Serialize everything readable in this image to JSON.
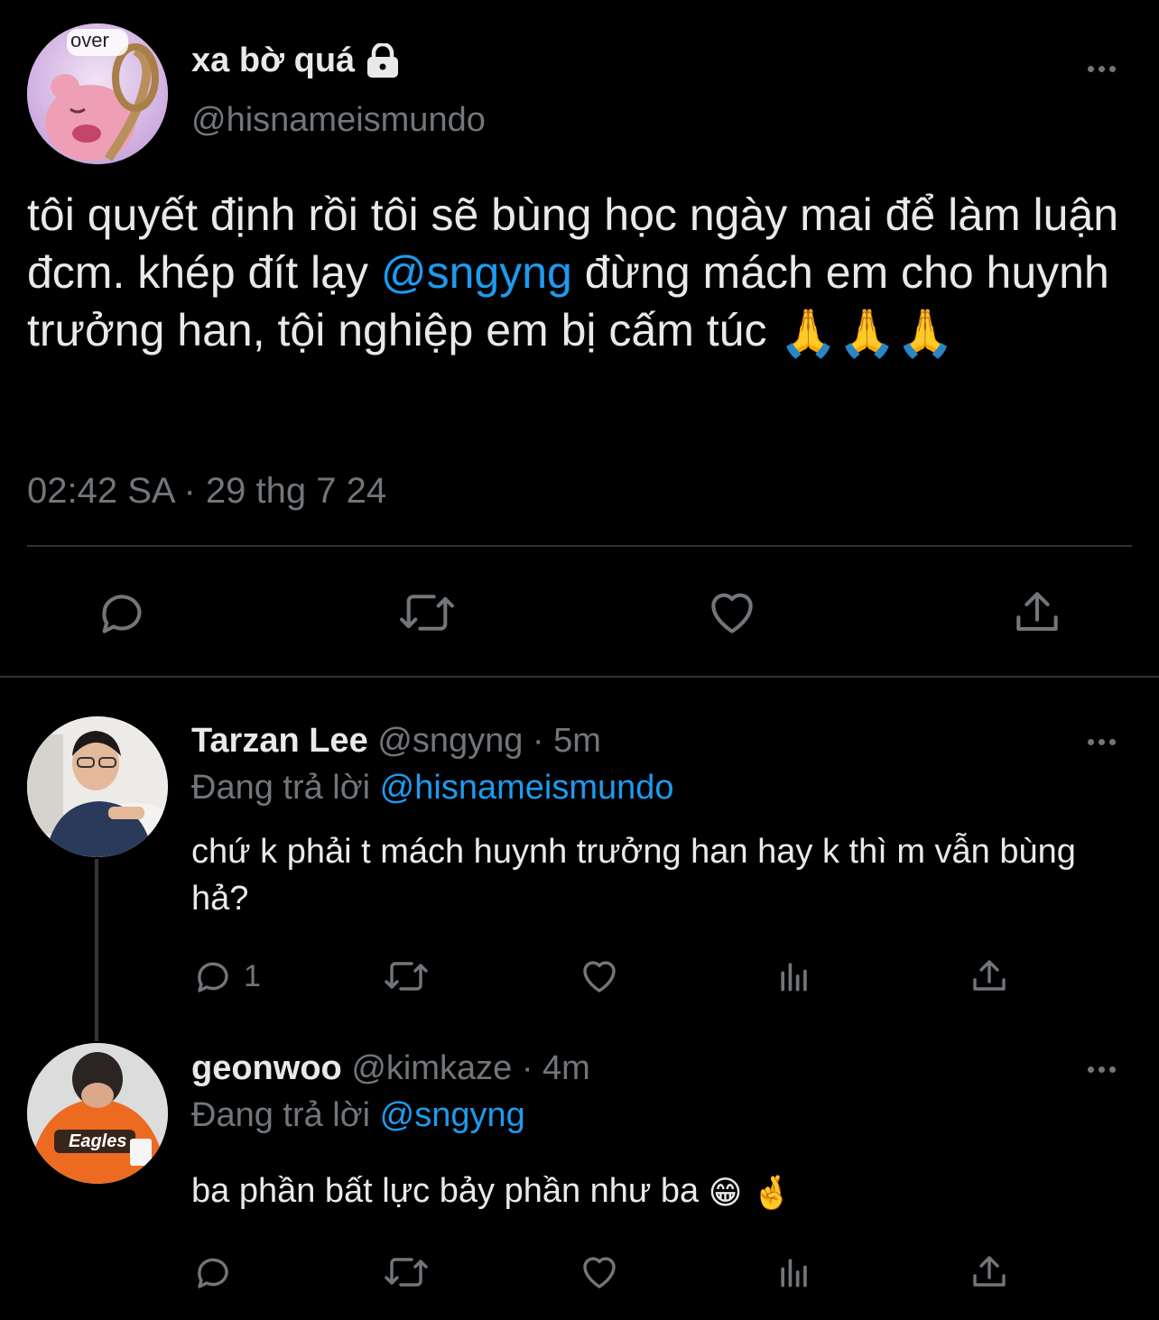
{
  "main_tweet": {
    "display_name": "xa bờ quá",
    "handle": "@hisnameismundo",
    "avatar_text": "over",
    "text_parts": [
      "tôi quyết định rồi tôi sẽ bùng học ngày mai để làm luận đcm. khép đít lạy ",
      "@sngyng",
      " đừng mách em cho huynh trưởng han, tội nghiệp em bị cấm túc "
    ],
    "timestamp": "02:42 SA · 29 thg 7 24",
    "actions": [
      "reply-icon",
      "retweet-icon",
      "like-icon",
      "share-icon"
    ]
  },
  "replies": [
    {
      "display_name": "Tarzan Lee",
      "handle_time": "@sngyng · 5m",
      "replying_prefix": "Đang trả lời ",
      "replying_to": "@hisnameismundo",
      "text": "chứ k phải t mách huynh trưởng han hay k thì m vẫn bùng hả?",
      "reply_count": "1"
    },
    {
      "display_name": "geonwoo",
      "handle_time": "@kimkaze · 4m",
      "replying_prefix": "Đang trả lời ",
      "replying_to": "@sngyng",
      "text": "ba phần bất lực bảy phần như ba ",
      "reply_count": ""
    }
  ],
  "colors": {
    "background": "#000000",
    "link": "#1d9bf0",
    "muted": "#71767b",
    "text": "#e7e9ea"
  }
}
